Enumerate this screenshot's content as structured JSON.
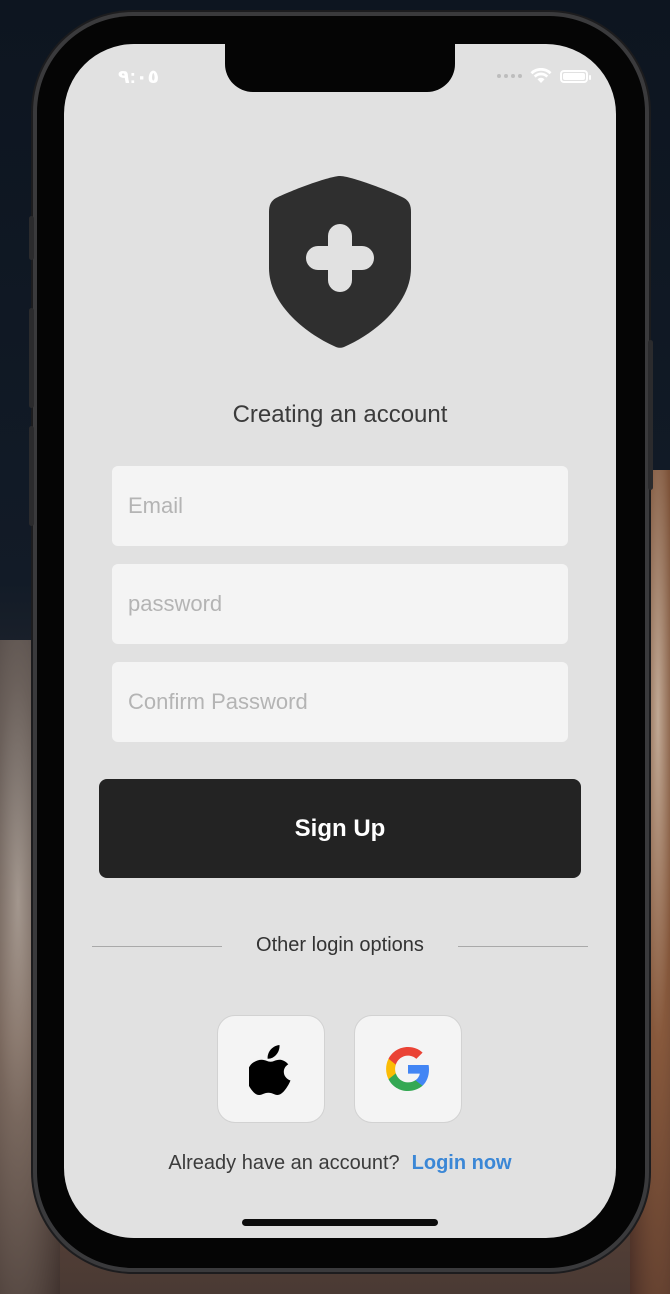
{
  "status_bar": {
    "time": "٩:٠٥"
  },
  "app": {
    "title": "Creating an account",
    "email_placeholder": "Email",
    "password_placeholder": "password",
    "confirm_placeholder": "Confirm Password",
    "signup_label": "Sign Up",
    "other_options_label": "Other login options",
    "social": [
      {
        "name": "Apple",
        "icon": "apple-icon"
      },
      {
        "name": "Google",
        "icon": "google-icon"
      }
    ],
    "account_prompt": "Already have an account?",
    "login_link": "Login now"
  },
  "colors": {
    "background": "#e1e1e1",
    "primary_button": "#232323",
    "link": "#3b87d6",
    "field_bg": "#f4f4f4"
  }
}
